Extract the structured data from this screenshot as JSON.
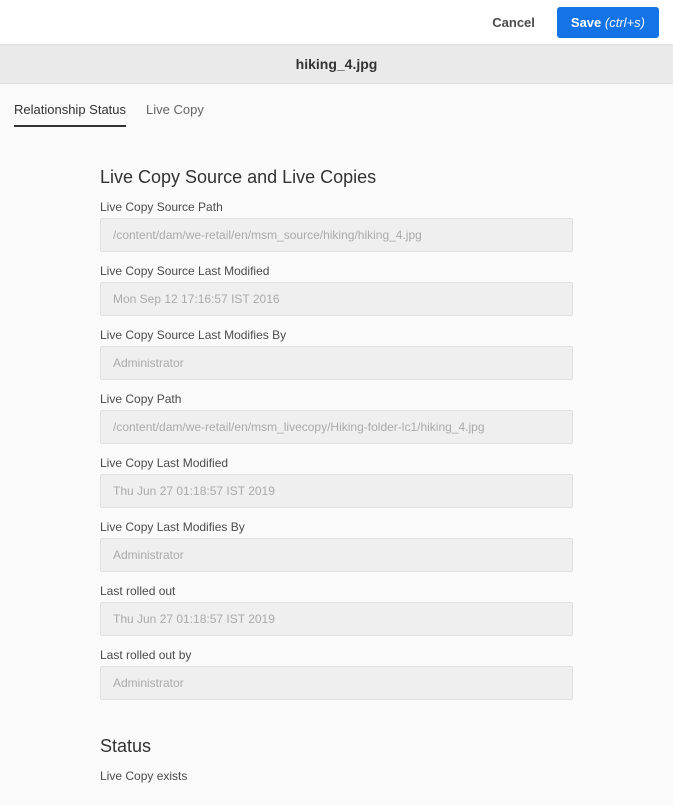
{
  "topbar": {
    "cancel_label": "Cancel",
    "save_label": "Save",
    "save_shortcut": "(ctrl+s)"
  },
  "title": "hiking_4.jpg",
  "tabs": {
    "relationship_status": "Relationship Status",
    "live_copy": "Live Copy"
  },
  "sections": {
    "live_copy_source": {
      "title": "Live Copy Source and Live Copies",
      "fields": {
        "source_path": {
          "label": "Live Copy Source Path",
          "value": "/content/dam/we-retail/en/msm_source/hiking/hiking_4.jpg"
        },
        "source_last_modified": {
          "label": "Live Copy Source Last Modified",
          "value": "Mon Sep 12 17:16:57 IST 2016"
        },
        "source_last_modified_by": {
          "label": "Live Copy Source Last Modifies By",
          "value": "Administrator"
        },
        "live_copy_path": {
          "label": "Live Copy Path",
          "value": "/content/dam/we-retail/en/msm_livecopy/Hiking-folder-lc1/hiking_4.jpg"
        },
        "live_copy_last_modified": {
          "label": "Live Copy Last Modified",
          "value": "Thu Jun 27 01:18:57 IST 2019"
        },
        "live_copy_last_modified_by": {
          "label": "Live Copy Last Modifies By",
          "value": "Administrator"
        },
        "last_rolled_out": {
          "label": "Last rolled out",
          "value": "Thu Jun 27 01:18:57 IST 2019"
        },
        "last_rolled_out_by": {
          "label": "Last rolled out by",
          "value": "Administrator"
        }
      }
    },
    "status": {
      "title": "Status",
      "live_copy_exists": "Live Copy exists"
    }
  }
}
